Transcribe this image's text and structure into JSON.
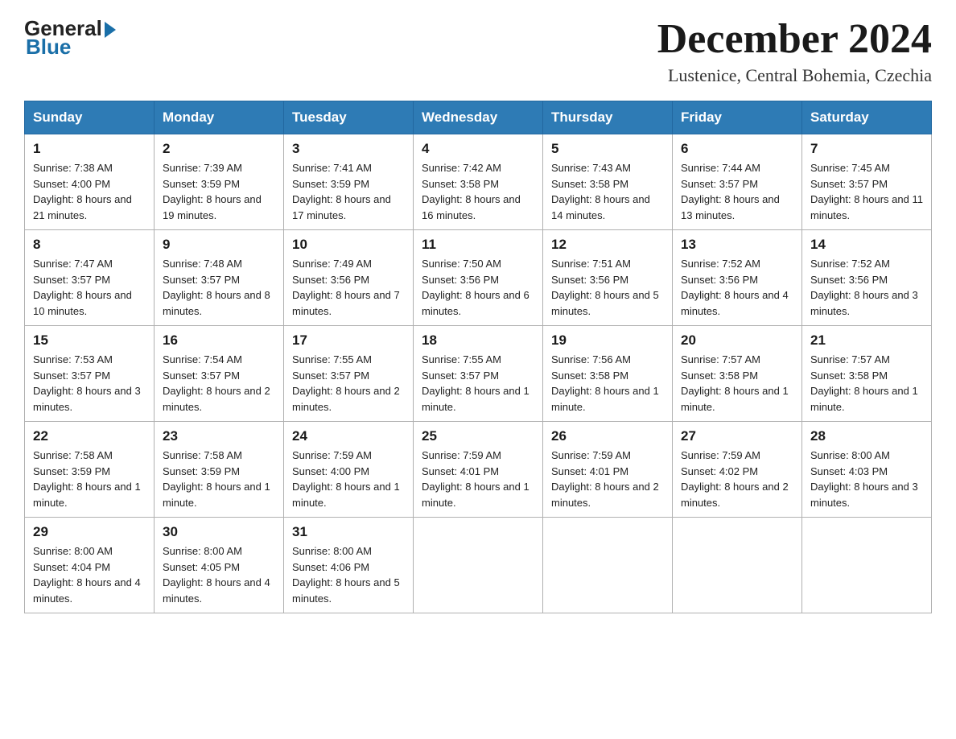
{
  "header": {
    "logo": {
      "general": "General",
      "blue": "Blue"
    },
    "title": "December 2024",
    "location": "Lustenice, Central Bohemia, Czechia"
  },
  "calendar": {
    "days_of_week": [
      "Sunday",
      "Monday",
      "Tuesday",
      "Wednesday",
      "Thursday",
      "Friday",
      "Saturday"
    ],
    "weeks": [
      [
        {
          "day": "1",
          "sunrise": "Sunrise: 7:38 AM",
          "sunset": "Sunset: 4:00 PM",
          "daylight": "Daylight: 8 hours and 21 minutes."
        },
        {
          "day": "2",
          "sunrise": "Sunrise: 7:39 AM",
          "sunset": "Sunset: 3:59 PM",
          "daylight": "Daylight: 8 hours and 19 minutes."
        },
        {
          "day": "3",
          "sunrise": "Sunrise: 7:41 AM",
          "sunset": "Sunset: 3:59 PM",
          "daylight": "Daylight: 8 hours and 17 minutes."
        },
        {
          "day": "4",
          "sunrise": "Sunrise: 7:42 AM",
          "sunset": "Sunset: 3:58 PM",
          "daylight": "Daylight: 8 hours and 16 minutes."
        },
        {
          "day": "5",
          "sunrise": "Sunrise: 7:43 AM",
          "sunset": "Sunset: 3:58 PM",
          "daylight": "Daylight: 8 hours and 14 minutes."
        },
        {
          "day": "6",
          "sunrise": "Sunrise: 7:44 AM",
          "sunset": "Sunset: 3:57 PM",
          "daylight": "Daylight: 8 hours and 13 minutes."
        },
        {
          "day": "7",
          "sunrise": "Sunrise: 7:45 AM",
          "sunset": "Sunset: 3:57 PM",
          "daylight": "Daylight: 8 hours and 11 minutes."
        }
      ],
      [
        {
          "day": "8",
          "sunrise": "Sunrise: 7:47 AM",
          "sunset": "Sunset: 3:57 PM",
          "daylight": "Daylight: 8 hours and 10 minutes."
        },
        {
          "day": "9",
          "sunrise": "Sunrise: 7:48 AM",
          "sunset": "Sunset: 3:57 PM",
          "daylight": "Daylight: 8 hours and 8 minutes."
        },
        {
          "day": "10",
          "sunrise": "Sunrise: 7:49 AM",
          "sunset": "Sunset: 3:56 PM",
          "daylight": "Daylight: 8 hours and 7 minutes."
        },
        {
          "day": "11",
          "sunrise": "Sunrise: 7:50 AM",
          "sunset": "Sunset: 3:56 PM",
          "daylight": "Daylight: 8 hours and 6 minutes."
        },
        {
          "day": "12",
          "sunrise": "Sunrise: 7:51 AM",
          "sunset": "Sunset: 3:56 PM",
          "daylight": "Daylight: 8 hours and 5 minutes."
        },
        {
          "day": "13",
          "sunrise": "Sunrise: 7:52 AM",
          "sunset": "Sunset: 3:56 PM",
          "daylight": "Daylight: 8 hours and 4 minutes."
        },
        {
          "day": "14",
          "sunrise": "Sunrise: 7:52 AM",
          "sunset": "Sunset: 3:56 PM",
          "daylight": "Daylight: 8 hours and 3 minutes."
        }
      ],
      [
        {
          "day": "15",
          "sunrise": "Sunrise: 7:53 AM",
          "sunset": "Sunset: 3:57 PM",
          "daylight": "Daylight: 8 hours and 3 minutes."
        },
        {
          "day": "16",
          "sunrise": "Sunrise: 7:54 AM",
          "sunset": "Sunset: 3:57 PM",
          "daylight": "Daylight: 8 hours and 2 minutes."
        },
        {
          "day": "17",
          "sunrise": "Sunrise: 7:55 AM",
          "sunset": "Sunset: 3:57 PM",
          "daylight": "Daylight: 8 hours and 2 minutes."
        },
        {
          "day": "18",
          "sunrise": "Sunrise: 7:55 AM",
          "sunset": "Sunset: 3:57 PM",
          "daylight": "Daylight: 8 hours and 1 minute."
        },
        {
          "day": "19",
          "sunrise": "Sunrise: 7:56 AM",
          "sunset": "Sunset: 3:58 PM",
          "daylight": "Daylight: 8 hours and 1 minute."
        },
        {
          "day": "20",
          "sunrise": "Sunrise: 7:57 AM",
          "sunset": "Sunset: 3:58 PM",
          "daylight": "Daylight: 8 hours and 1 minute."
        },
        {
          "day": "21",
          "sunrise": "Sunrise: 7:57 AM",
          "sunset": "Sunset: 3:58 PM",
          "daylight": "Daylight: 8 hours and 1 minute."
        }
      ],
      [
        {
          "day": "22",
          "sunrise": "Sunrise: 7:58 AM",
          "sunset": "Sunset: 3:59 PM",
          "daylight": "Daylight: 8 hours and 1 minute."
        },
        {
          "day": "23",
          "sunrise": "Sunrise: 7:58 AM",
          "sunset": "Sunset: 3:59 PM",
          "daylight": "Daylight: 8 hours and 1 minute."
        },
        {
          "day": "24",
          "sunrise": "Sunrise: 7:59 AM",
          "sunset": "Sunset: 4:00 PM",
          "daylight": "Daylight: 8 hours and 1 minute."
        },
        {
          "day": "25",
          "sunrise": "Sunrise: 7:59 AM",
          "sunset": "Sunset: 4:01 PM",
          "daylight": "Daylight: 8 hours and 1 minute."
        },
        {
          "day": "26",
          "sunrise": "Sunrise: 7:59 AM",
          "sunset": "Sunset: 4:01 PM",
          "daylight": "Daylight: 8 hours and 2 minutes."
        },
        {
          "day": "27",
          "sunrise": "Sunrise: 7:59 AM",
          "sunset": "Sunset: 4:02 PM",
          "daylight": "Daylight: 8 hours and 2 minutes."
        },
        {
          "day": "28",
          "sunrise": "Sunrise: 8:00 AM",
          "sunset": "Sunset: 4:03 PM",
          "daylight": "Daylight: 8 hours and 3 minutes."
        }
      ],
      [
        {
          "day": "29",
          "sunrise": "Sunrise: 8:00 AM",
          "sunset": "Sunset: 4:04 PM",
          "daylight": "Daylight: 8 hours and 4 minutes."
        },
        {
          "day": "30",
          "sunrise": "Sunrise: 8:00 AM",
          "sunset": "Sunset: 4:05 PM",
          "daylight": "Daylight: 8 hours and 4 minutes."
        },
        {
          "day": "31",
          "sunrise": "Sunrise: 8:00 AM",
          "sunset": "Sunset: 4:06 PM",
          "daylight": "Daylight: 8 hours and 5 minutes."
        },
        null,
        null,
        null,
        null
      ]
    ]
  }
}
